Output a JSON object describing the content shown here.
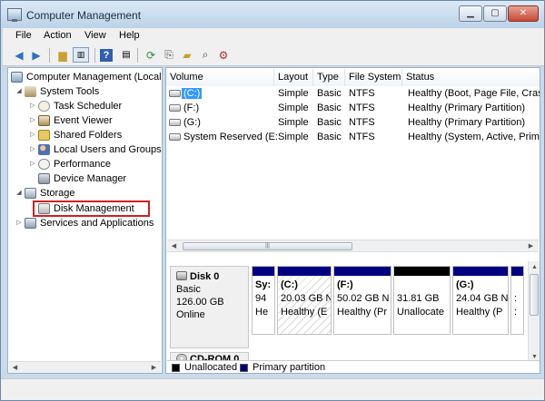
{
  "window": {
    "title": "Computer Management"
  },
  "menu": [
    "File",
    "Action",
    "View",
    "Help"
  ],
  "toolbar_icons": [
    "back-arrow-icon",
    "forward-arrow-icon",
    "up-folder-icon",
    "show-hide-tree-icon",
    "help-icon",
    "properties-icon",
    "refresh-icon",
    "export-icon",
    "open-icon",
    "search-icon",
    "settings-icon"
  ],
  "tree": [
    {
      "label": "Computer Management (Local",
      "icon": "computer-icon"
    },
    {
      "label": "System Tools",
      "icon": "system-tools-icon"
    },
    {
      "label": "Task Scheduler",
      "icon": "clock-icon"
    },
    {
      "label": "Event Viewer",
      "icon": "event-viewer-icon"
    },
    {
      "label": "Shared Folders",
      "icon": "shared-folder-icon"
    },
    {
      "label": "Local Users and Groups",
      "icon": "users-icon"
    },
    {
      "label": "Performance",
      "icon": "performance-icon"
    },
    {
      "label": "Device Manager",
      "icon": "device-manager-icon"
    },
    {
      "label": "Storage",
      "icon": "storage-icon"
    },
    {
      "label": "Disk Management",
      "icon": "disk-management-icon"
    },
    {
      "label": "Services and Applications",
      "icon": "services-icon"
    }
  ],
  "volume_list": {
    "columns": [
      "Volume",
      "Layout",
      "Type",
      "File System",
      "Status"
    ],
    "rows": [
      [
        "(C:)",
        "Simple",
        "Basic",
        "NTFS",
        "Healthy (Boot, Page File, Crash"
      ],
      [
        "(F:)",
        "Simple",
        "Basic",
        "NTFS",
        "Healthy (Primary Partition)"
      ],
      [
        "(G:)",
        "Simple",
        "Basic",
        "NTFS",
        "Healthy (Primary Partition)"
      ],
      [
        "System Reserved (E:)",
        "Simple",
        "Basic",
        "NTFS",
        "Healthy (System, Active, Prima"
      ]
    ]
  },
  "disk0": {
    "name": "Disk 0",
    "type": "Basic",
    "size": "126.00 GB",
    "status": "Online",
    "partitions": [
      {
        "line1": "Sy:",
        "line2": "94",
        "line3": "He",
        "color": "#000080"
      },
      {
        "line1": "(C:)",
        "line2": "20.03 GB N",
        "line3": "Healthy (E",
        "color": "#000080"
      },
      {
        "line1": "(F:)",
        "line2": "50.02 GB N",
        "line3": "Healthy (Pr",
        "color": "#000080"
      },
      {
        "line1": "",
        "line2": "31.81 GB",
        "line3": "Unallocate",
        "color": "#000000"
      },
      {
        "line1": "(G:)",
        "line2": "24.04 GB N",
        "line3": "Healthy (P",
        "color": "#000080"
      },
      {
        "line1": "",
        "line2": "",
        "line3": "",
        "color": "#000080"
      }
    ]
  },
  "cdrom": {
    "name": "CD-ROM 0"
  },
  "legend": [
    {
      "label": "Unallocated",
      "color": "#000000"
    },
    {
      "label": "Primary partition",
      "color": "#000080"
    }
  ]
}
